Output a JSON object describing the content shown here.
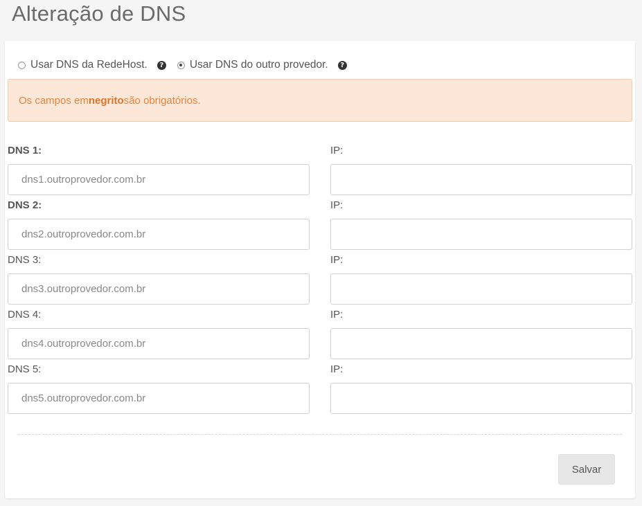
{
  "page": {
    "title": "Alteração de DNS"
  },
  "dns_option": {
    "option_redehost": "Usar DNS da RedeHost.",
    "option_other": "Usar DNS do outro provedor.",
    "selected": "option_other",
    "help_icon_glyph": "?"
  },
  "alert": {
    "prefix": "Os campos em ",
    "bold": "negrito",
    "suffix": " são obrigatórios."
  },
  "rows": [
    {
      "dns_label": "DNS 1:",
      "dns_required": true,
      "dns_placeholder": "dns1.outroprovedor.com.br",
      "ip_label": "IP:",
      "ip_value": ""
    },
    {
      "dns_label": "DNS 2:",
      "dns_required": true,
      "dns_placeholder": "dns2.outroprovedor.com.br",
      "ip_label": "IP:",
      "ip_value": ""
    },
    {
      "dns_label": "DNS 3:",
      "dns_required": false,
      "dns_placeholder": "dns3.outroprovedor.com.br",
      "ip_label": "IP:",
      "ip_value": ""
    },
    {
      "dns_label": "DNS 4:",
      "dns_required": false,
      "dns_placeholder": "dns4.outroprovedor.com.br",
      "ip_label": "IP:",
      "ip_value": ""
    },
    {
      "dns_label": "DNS 5:",
      "dns_required": false,
      "dns_placeholder": "dns5.outroprovedor.com.br",
      "ip_label": "IP:",
      "ip_value": ""
    }
  ],
  "actions": {
    "save_label": "Salvar"
  }
}
